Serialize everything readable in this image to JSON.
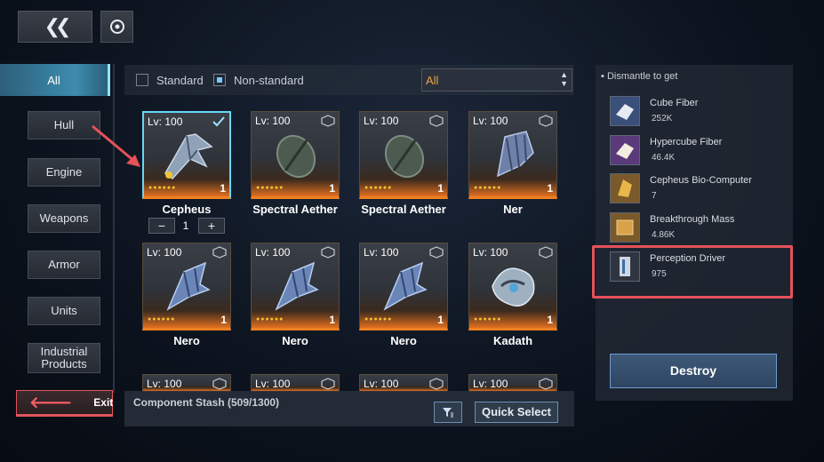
{
  "top": {
    "back_icon": "double-chevron-left-icon",
    "settings_icon": "ring-icon"
  },
  "categories": [
    {
      "label": "All",
      "active": true
    },
    {
      "label": "Hull"
    },
    {
      "label": "Engine"
    },
    {
      "label": "Weapons"
    },
    {
      "label": "Armor"
    },
    {
      "label": "Units"
    },
    {
      "label": "Industrial Products"
    }
  ],
  "exit_label": "Exit",
  "filters": {
    "standard_label": "Standard",
    "nonstandard_label": "Non-standard",
    "standard_checked": false,
    "nonstandard_checked": true,
    "select_value": "All"
  },
  "grid": [
    {
      "lv": "Lv: 100",
      "name": "Cepheus",
      "count": "1",
      "selected": true
    },
    {
      "lv": "Lv: 100",
      "name": "Spectral Aether",
      "count": "1"
    },
    {
      "lv": "Lv: 100",
      "name": "Spectral Aether",
      "count": "1"
    },
    {
      "lv": "Lv: 100",
      "name": "Ner",
      "count": "1"
    },
    {
      "lv": "Lv: 100",
      "name": "Nero",
      "count": "1"
    },
    {
      "lv": "Lv: 100",
      "name": "Nero",
      "count": "1"
    },
    {
      "lv": "Lv: 100",
      "name": "Nero",
      "count": "1"
    },
    {
      "lv": "Lv: 100",
      "name": "Kadath",
      "count": "1"
    },
    {
      "lv": "Lv: 100"
    },
    {
      "lv": "Lv: 100"
    },
    {
      "lv": "Lv: 100"
    },
    {
      "lv": "Lv: 100"
    }
  ],
  "quantity": {
    "minus": "−",
    "value": "1",
    "plus": "+"
  },
  "stash": {
    "text": "Component Stash (509/1300)",
    "quick_select_label": "Quick Select",
    "filter_icon": "filter-icon"
  },
  "dismantle": {
    "title": "Dismantle to get",
    "items": [
      {
        "name": "Cube Fiber",
        "qty": "252K",
        "color": "#3a4f7a"
      },
      {
        "name": "Hypercube Fiber",
        "qty": "46.4K",
        "color": "#5a3a7a"
      },
      {
        "name": "Cepheus Bio-Computer",
        "qty": "7",
        "color": "#7a5a2a"
      },
      {
        "name": "Breakthrough Mass",
        "qty": "4.86K",
        "color": "#7a5a2a"
      },
      {
        "name": "Perception Driver",
        "qty": "975",
        "color": "#2f3642"
      }
    ],
    "destroy_label": "Destroy"
  },
  "colors": {
    "accent_cyan": "#67d7f6",
    "rarity_orange": "#f08020",
    "highlight_red": "#e4525a"
  }
}
